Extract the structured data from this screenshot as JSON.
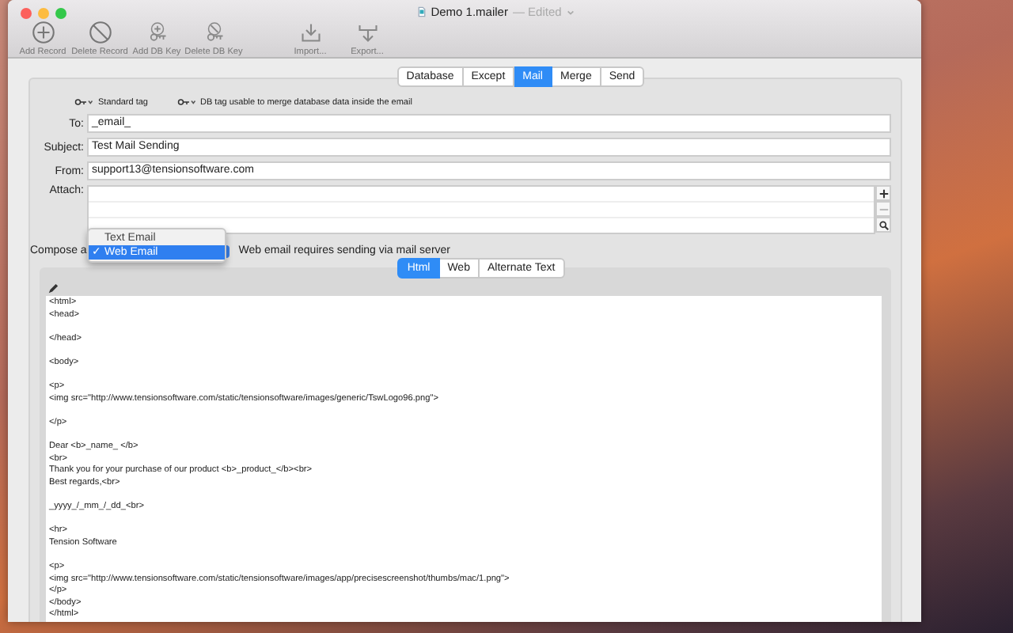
{
  "window": {
    "title": "Demo 1.mailer",
    "title_status": "— Edited"
  },
  "toolbar": [
    {
      "label": "Add Record",
      "kind": "add"
    },
    {
      "label": "Delete Record",
      "kind": "delete"
    },
    {
      "label": "Add DB Key",
      "kind": "addkey"
    },
    {
      "label": "Delete DB Key",
      "kind": "deletekey"
    },
    {
      "label": "Import...",
      "kind": "import"
    },
    {
      "label": "Export...",
      "kind": "export"
    }
  ],
  "tabs": [
    {
      "label": "Database",
      "selected": false
    },
    {
      "label": "Except",
      "selected": false
    },
    {
      "label": "Mail",
      "selected": true
    },
    {
      "label": "Merge",
      "selected": false
    },
    {
      "label": "Send",
      "selected": false
    }
  ],
  "legend": [
    {
      "label": "Standard tag"
    },
    {
      "label": "DB tag usable to merge database data inside the email"
    }
  ],
  "fields": [
    {
      "label": "To:",
      "value": "_email_"
    },
    {
      "label": "Subject:",
      "value": "Test Mail Sending"
    },
    {
      "label": "From:",
      "value": "support13@tensionsoftware.com"
    }
  ],
  "attach": {
    "label": "Attach:"
  },
  "compose": {
    "label": "Compose a",
    "note": "Web email requires sending via mail server",
    "menu": [
      {
        "label": "Text Email",
        "selected": false
      },
      {
        "label": "Web Email",
        "selected": true
      }
    ],
    "check": "✓"
  },
  "editor_tabs": [
    {
      "label": "Html",
      "selected": true
    },
    {
      "label": "Web",
      "selected": false
    },
    {
      "label": "Alternate Text",
      "selected": false
    }
  ],
  "editor_paragraphs": [
    {
      "lines": [
        "<html>",
        "<head>"
      ]
    },
    {
      "lines": [
        "</head>"
      ]
    },
    {
      "lines": [
        "<body>"
      ]
    },
    {
      "lines": [
        "<p>",
        "<img src=\"http://www.tensionsoftware.com/static/tensionsoftware/images/generic/TswLogo96.png\">"
      ]
    },
    {
      "lines": [
        "</p>"
      ]
    },
    {
      "lines": [
        "Dear <b>_name_ </b>",
        "<br>",
        "Thank you for your purchase of our product <b>_product_</b><br>",
        "Best regards,<br>"
      ]
    },
    {
      "lines": [
        "_yyyy_/_mm_/_dd_<br>"
      ]
    },
    {
      "lines": [
        "<hr>",
        "Tension Software"
      ]
    },
    {
      "lines": [
        "<p>",
        "<img src=\"http://www.tensionsoftware.com/static/tensionsoftware/images/app/precisescreenshot/thumbs/mac/1.png\">",
        "</p>",
        "</body>",
        "</html>"
      ]
    }
  ]
}
